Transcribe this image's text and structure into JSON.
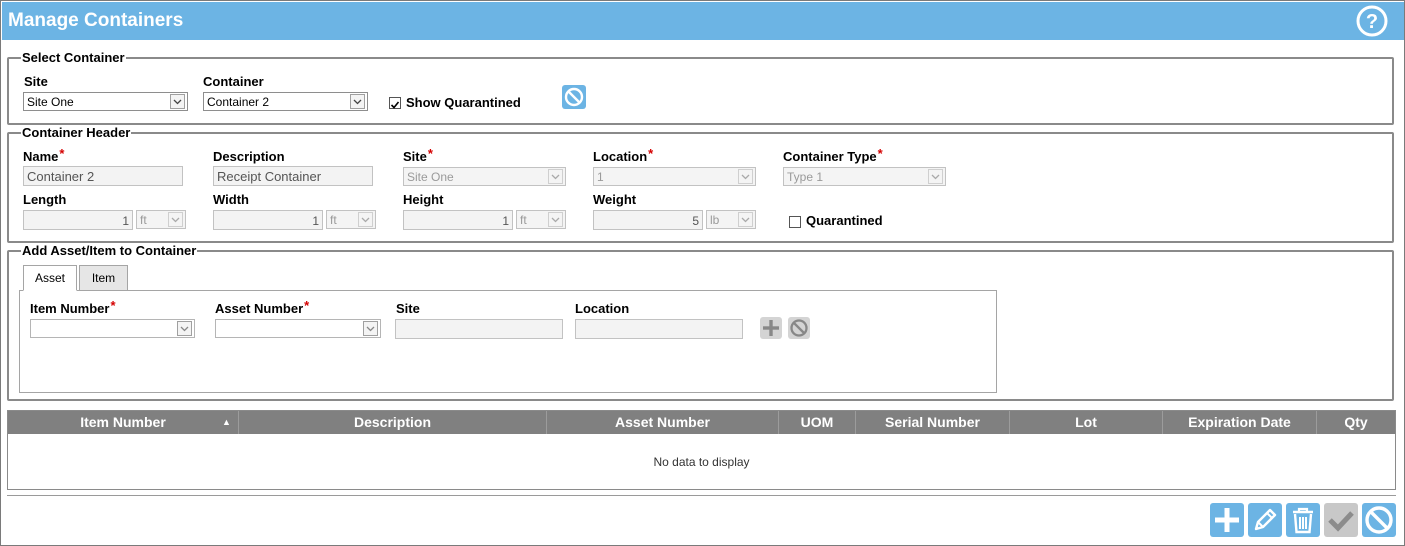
{
  "window": {
    "title": "Manage Containers"
  },
  "select_container": {
    "legend": "Select Container",
    "site_label": "Site",
    "site_value": "Site One",
    "container_label": "Container",
    "container_value": "Container 2",
    "show_quarantined_label": "Show Quarantined",
    "show_quarantined_checked": true
  },
  "header": {
    "legend": "Container Header",
    "name_label": "Name",
    "name_value": "Container 2",
    "description_label": "Description",
    "description_value": "Receipt Container",
    "site_label": "Site",
    "site_value": "Site One",
    "location_label": "Location",
    "location_value": "1",
    "type_label": "Container Type",
    "type_value": "Type 1",
    "length_label": "Length",
    "length_value": "1",
    "length_unit": "ft",
    "width_label": "Width",
    "width_value": "1",
    "width_unit": "ft",
    "height_label": "Height",
    "height_value": "1",
    "height_unit": "ft",
    "weight_label": "Weight",
    "weight_value": "5",
    "weight_unit": "lb",
    "quarantined_label": "Quarantined",
    "quarantined_checked": false
  },
  "add_asset": {
    "legend": "Add Asset/Item to Container",
    "tabs": [
      "Asset",
      "Item"
    ],
    "active_tab": "Asset",
    "item_number_label": "Item Number",
    "asset_number_label": "Asset Number",
    "site_label": "Site",
    "location_label": "Location"
  },
  "grid": {
    "columns": [
      "Item Number",
      "Description",
      "Asset Number",
      "UOM",
      "Serial Number",
      "Lot",
      "Expiration Date",
      "Qty"
    ],
    "sort_indicator": "▲",
    "empty_text": "No data to display"
  },
  "toolbar": {
    "buttons": [
      "add-icon",
      "edit-icon",
      "delete-icon",
      "check-icon",
      "cancel-icon"
    ]
  },
  "colors": {
    "accent": "#6cb4e4",
    "grid_header": "#808080",
    "required": "#d40000"
  }
}
